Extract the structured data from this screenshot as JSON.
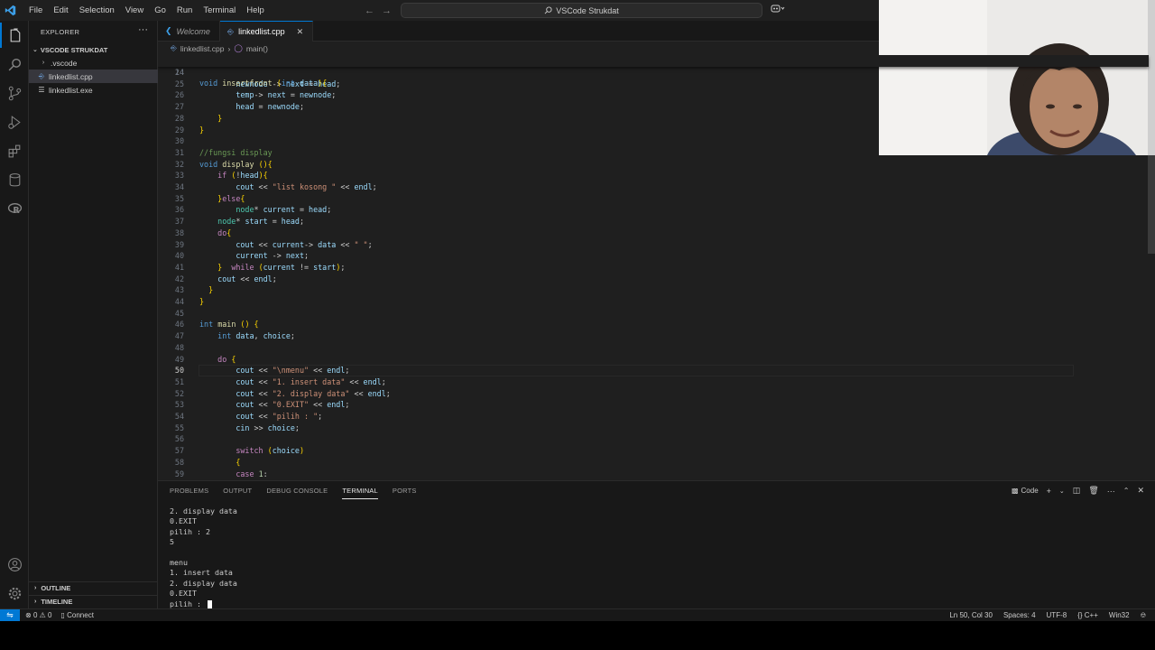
{
  "menu": [
    "File",
    "Edit",
    "Selection",
    "View",
    "Go",
    "Run",
    "Terminal",
    "Help"
  ],
  "search": {
    "text": "VSCode Strukdat"
  },
  "explorer": {
    "title": "EXPLORER",
    "folder": "VSCODE STRUKDAT",
    "items": [
      {
        "label": ".vscode",
        "icon": "chevron-right-icon"
      },
      {
        "label": "linkedlist.cpp",
        "icon": "cpp-file-icon",
        "selected": true
      },
      {
        "label": "linkedlist.exe",
        "icon": "file-icon"
      }
    ],
    "outline": "OUTLINE",
    "timeline": "TIMELINE"
  },
  "tabs": [
    {
      "label": "Welcome",
      "italic": true
    },
    {
      "label": "linkedlist.cpp",
      "active": true
    }
  ],
  "breadcrumb": {
    "file": "linkedlist.cpp",
    "symbol": "main()"
  },
  "sticky_line": {
    "n": "14",
    "text": "void insertfront (int data){"
  },
  "code_lines": [
    {
      "n": "24",
      "text": ""
    },
    {
      "n": "25",
      "text": "        newnode -> next = head;"
    },
    {
      "n": "26",
      "text": "        temp-> next = newnode;"
    },
    {
      "n": "27",
      "text": "        head = newnode;"
    },
    {
      "n": "28",
      "text": "    }"
    },
    {
      "n": "29",
      "text": "}"
    },
    {
      "n": "30",
      "text": ""
    },
    {
      "n": "31",
      "text": "//fungsi display"
    },
    {
      "n": "32",
      "text": "void display (){"
    },
    {
      "n": "33",
      "text": "    if (!head){"
    },
    {
      "n": "34",
      "text": "        cout << \"list kosong \" << endl;"
    },
    {
      "n": "35",
      "text": "    }else{"
    },
    {
      "n": "36",
      "text": "        node* current = head;"
    },
    {
      "n": "37",
      "text": "    node* start = head;"
    },
    {
      "n": "38",
      "text": "    do{"
    },
    {
      "n": "39",
      "text": "        cout << current-> data << \" \";"
    },
    {
      "n": "40",
      "text": "        current -> next;"
    },
    {
      "n": "41",
      "text": "    }  while (current != start);"
    },
    {
      "n": "42",
      "text": "    cout << endl;"
    },
    {
      "n": "43",
      "text": "  }"
    },
    {
      "n": "44",
      "text": "}"
    },
    {
      "n": "45",
      "text": ""
    },
    {
      "n": "46",
      "text": "int main () {"
    },
    {
      "n": "47",
      "text": "    int data, choice;"
    },
    {
      "n": "48",
      "text": ""
    },
    {
      "n": "49",
      "text": "    do {"
    },
    {
      "n": "50",
      "text": "        cout << \"\\nmenu\" << endl;"
    },
    {
      "n": "51",
      "text": "        cout << \"1. insert data\" << endl;"
    },
    {
      "n": "52",
      "text": "        cout << \"2. display data\" << endl;"
    },
    {
      "n": "53",
      "text": "        cout << \"0.EXIT\" << endl;"
    },
    {
      "n": "54",
      "text": "        cout << \"pilih : \";"
    },
    {
      "n": "55",
      "text": "        cin >> choice;"
    },
    {
      "n": "56",
      "text": ""
    },
    {
      "n": "57",
      "text": "        switch (choice)"
    },
    {
      "n": "58",
      "text": "        {"
    },
    {
      "n": "59",
      "text": "        case 1:"
    }
  ],
  "panel": {
    "tabs": [
      "PROBLEMS",
      "OUTPUT",
      "DEBUG CONSOLE",
      "TERMINAL",
      "PORTS"
    ],
    "active_tab": "TERMINAL",
    "shell_label": "Code",
    "terminal_lines": [
      "2. display data",
      "0.EXIT",
      "pilih : 2",
      "5",
      "",
      "menu",
      "1. insert data",
      "2. display data",
      "0.EXIT",
      "pilih : "
    ]
  },
  "status": {
    "errors": "0",
    "warnings": "0",
    "connect": "Connect",
    "position": "Ln 50, Col 30",
    "spaces": "Spaces: 4",
    "encoding": "UTF-8",
    "language": "C++",
    "platform": "Win32"
  },
  "colors": {
    "accent": "#0078d4",
    "editor_bg": "#1f1f1f",
    "sidebar_bg": "#181818"
  }
}
